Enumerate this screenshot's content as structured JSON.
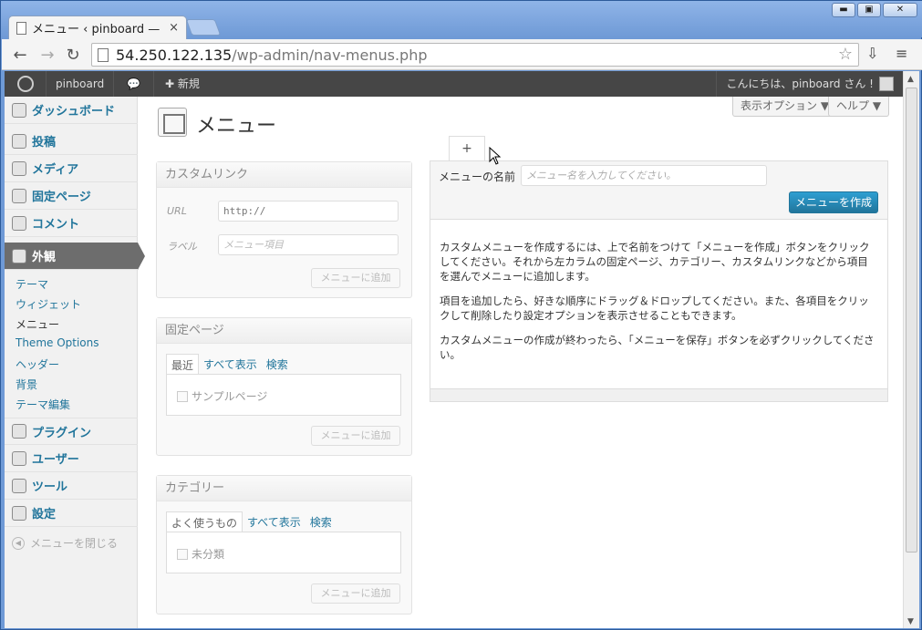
{
  "browser": {
    "tab_title": "メニュー ‹ pinboard — W",
    "tab_close": "×",
    "url_host": "54.250.122.135",
    "url_path": "/wp-admin/nav-menus.php",
    "win_min": "▬",
    "win_max": "▣",
    "win_close": "✕"
  },
  "adminbar": {
    "site_name": "pinboard",
    "new_label": "新規",
    "howdy": "こんにちは、pinboard さん !"
  },
  "screen_options": {
    "options_label": "表示オプション ▼",
    "help_label": "ヘルプ ▼"
  },
  "sidebar": {
    "dashboard": "ダッシュボード",
    "posts": "投稿",
    "media": "メディア",
    "pages": "固定ページ",
    "comments": "コメント",
    "appearance": "外観",
    "sub": [
      "テーマ",
      "ウィジェット",
      "メニュー",
      "Theme Options",
      "ヘッダー",
      "背景",
      "テーマ編集"
    ],
    "plugins": "プラグイン",
    "users": "ユーザー",
    "tools": "ツール",
    "settings": "設定",
    "collapse": "メニューを閉じる"
  },
  "page": {
    "title": "メニュー",
    "add_tab": "+"
  },
  "custom_links": {
    "header": "カスタムリンク",
    "url_label": "URL",
    "url_value": "http://",
    "label_label": "ラベル",
    "label_placeholder": "メニュー項目",
    "add_button": "メニューに追加"
  },
  "pages_box": {
    "header": "固定ページ",
    "tabs": [
      "最近",
      "すべて表示",
      "検索"
    ],
    "item": "サンプルページ",
    "add_button": "メニューに追加"
  },
  "categories_box": {
    "header": "カテゴリー",
    "tabs": [
      "よく使うもの",
      "すべて表示",
      "検索"
    ],
    "item": "未分類",
    "add_button": "メニューに追加"
  },
  "editor": {
    "name_label": "メニューの名前",
    "name_placeholder": "メニュー名を入力してください。",
    "create_button": "メニューを作成",
    "p1": "カスタムメニューを作成するには、上で名前をつけて「メニューを作成」ボタンをクリックしてください。それから左カラムの固定ページ、カテゴリー、カスタムリンクなどから項目を選んでメニューに追加します。",
    "p2": "項目を追加したら、好きな順序にドラッグ＆ドロップしてください。また、各項目をクリックして削除したり設定オプションを表示させることもできます。",
    "p3": "カスタムメニューの作成が終わったら、「メニューを保存」ボタンを必ずクリックしてください。"
  },
  "colors": {
    "link": "#21759b",
    "adminbar": "#464646",
    "active_menu": "#6d6d6d",
    "primary_button": "#21759b"
  }
}
